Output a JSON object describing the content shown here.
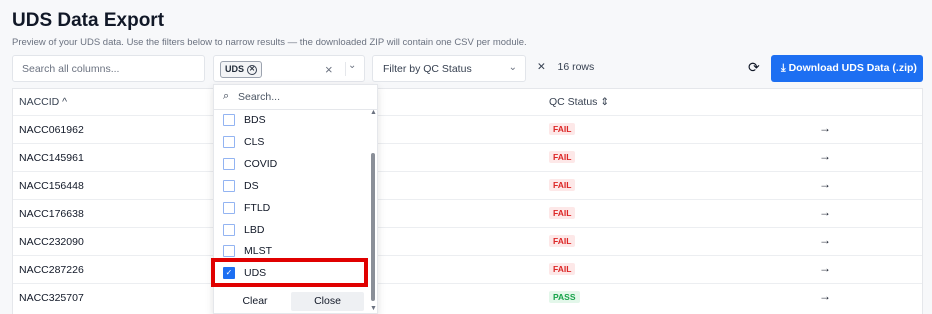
{
  "header": {
    "title": "UDS Data Export",
    "subtitle": "Preview of your UDS data. Use the filters below to narrow results — the downloaded ZIP will contain one CSV per module."
  },
  "toolbar": {
    "search_placeholder": "Search all columns...",
    "module_chip": "UDS",
    "qc_placeholder": "Filter by QC Status",
    "rows_label": "16 rows",
    "download_label": "Download UDS Data (.zip)",
    "clear_glyph": "×",
    "rows_clear_glyph": "✕"
  },
  "table": {
    "headers": {
      "naccid": "NACCID ^",
      "qc": "QC Status ⇕"
    },
    "rows": [
      {
        "id": "NACC061962",
        "status": "FAIL"
      },
      {
        "id": "NACC145961",
        "status": "FAIL"
      },
      {
        "id": "NACC156448",
        "status": "FAIL"
      },
      {
        "id": "NACC176638",
        "status": "FAIL"
      },
      {
        "id": "NACC232090",
        "status": "FAIL"
      },
      {
        "id": "NACC287226",
        "status": "FAIL"
      },
      {
        "id": "NACC325707",
        "status": "PASS"
      }
    ]
  },
  "dropdown": {
    "search_placeholder": "Search...",
    "options": [
      {
        "label": "BDS",
        "checked": false
      },
      {
        "label": "CLS",
        "checked": false
      },
      {
        "label": "COVID",
        "checked": false
      },
      {
        "label": "DS",
        "checked": false
      },
      {
        "label": "FTLD",
        "checked": false
      },
      {
        "label": "LBD",
        "checked": false
      },
      {
        "label": "MLST",
        "checked": false
      },
      {
        "label": "UDS",
        "checked": true
      }
    ],
    "clear_label": "Clear",
    "close_label": "Close"
  },
  "colors": {
    "accent": "#1d6ff2",
    "fail": "#dc2626",
    "pass": "#16a34a",
    "highlight": "#e00000"
  }
}
